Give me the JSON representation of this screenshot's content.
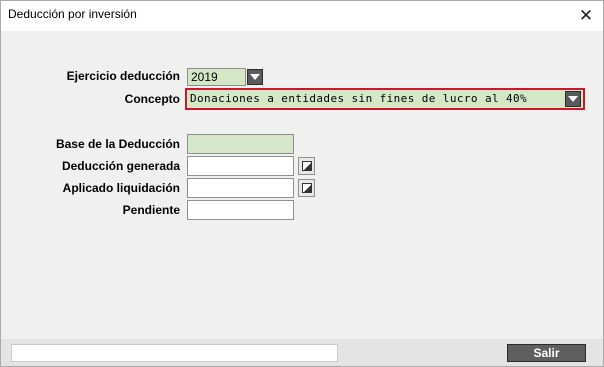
{
  "window": {
    "title": "Deducción por inversión",
    "close_glyph": "✕"
  },
  "form": {
    "ejercicio_label": "Ejercicio deducción",
    "ejercicio_value": "2019",
    "concepto_label": "Concepto",
    "concepto_value": "Donaciones a entidades sin fines de lucro al 40%",
    "base_label": "Base de la Deducción",
    "base_value": "",
    "generada_label": "Deducción generada",
    "generada_value": "",
    "aplicado_label": "Aplicado liquidación",
    "aplicado_value": "",
    "pendiente_label": "Pendiente",
    "pendiente_value": ""
  },
  "footer": {
    "status_text": "",
    "salir_label": "Salir"
  },
  "colors": {
    "field_green": "#d4e8c8",
    "highlight_red": "#d0142a",
    "button_dark": "#5f5f5f"
  }
}
